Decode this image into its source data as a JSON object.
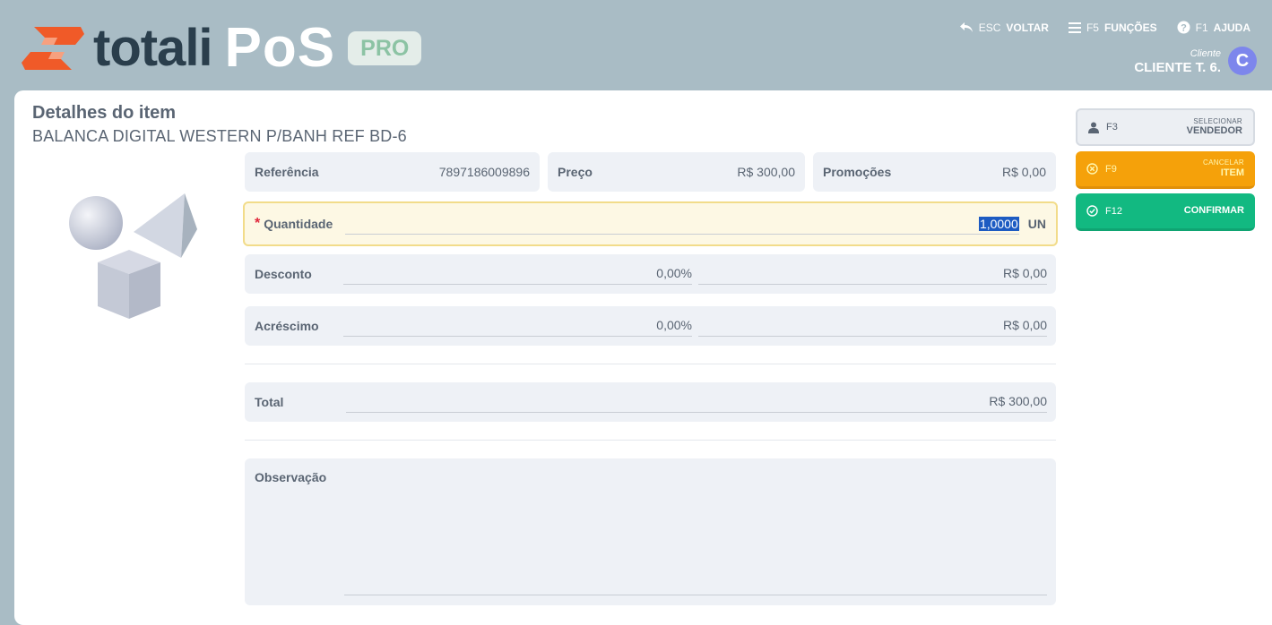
{
  "brand": {
    "name": "totali",
    "product": "PoS",
    "edition": "PRO"
  },
  "topnav": [
    {
      "key": "ESC",
      "label": "VOLTAR",
      "icon": "undo-arrow-icon"
    },
    {
      "key": "F5",
      "label": "FUNÇÕES",
      "icon": "menu-lines-icon"
    },
    {
      "key": "F1",
      "label": "AJUDA",
      "icon": "help-circle-icon"
    }
  ],
  "client": {
    "caption": "Cliente",
    "name": "CLIENTE T. 6.",
    "initial": "C"
  },
  "item": {
    "heading": "Detalhes do item",
    "description": "BALANCA DIGITAL WESTERN P/BANH REF BD-6"
  },
  "fields": {
    "referencia": {
      "label": "Referência",
      "value": "7897186009896"
    },
    "preco": {
      "label": "Preço",
      "value": "R$ 300,00"
    },
    "promocoes": {
      "label": "Promoções",
      "value": "R$ 0,00"
    },
    "quantidade": {
      "required_mark": "*",
      "label": "Quantidade",
      "value": "1,0000",
      "unit": "UN"
    },
    "desconto": {
      "label": "Desconto",
      "percent": "0,00%",
      "amount": "R$ 0,00"
    },
    "acrescimo": {
      "label": "Acréscimo",
      "percent": "0,00%",
      "amount": "R$ 0,00"
    },
    "total": {
      "label": "Total",
      "value": "R$ 300,00"
    },
    "observacao": {
      "label": "Observação",
      "value": ""
    }
  },
  "actions": {
    "vendedor": {
      "key": "F3",
      "small": "SELECIONAR",
      "big": "VENDEDOR",
      "icon": "person-icon"
    },
    "cancelar": {
      "key": "F9",
      "small": "CANCELAR",
      "big": "ITEM",
      "icon": "x-circle-icon"
    },
    "confirmar": {
      "key": "F12",
      "big": "CONFIRMAR",
      "icon": "check-circle-icon"
    }
  },
  "colors": {
    "header_bg": "#a9bcc5",
    "brand_orange": "#f05a28",
    "cancel": "#f5a10a",
    "confirm": "#12b981",
    "avatar": "#7d86ec"
  }
}
